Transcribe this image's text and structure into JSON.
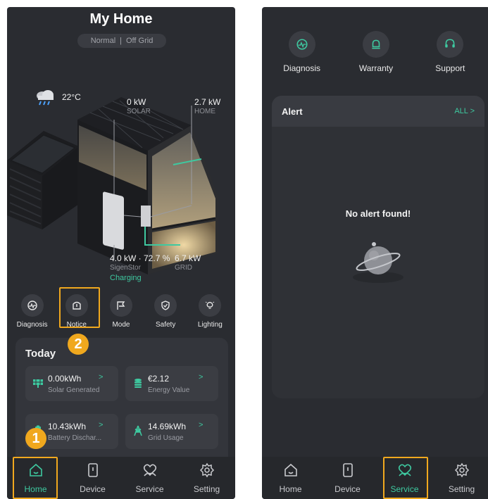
{
  "left": {
    "title": "My Home",
    "mode": {
      "normal": "Normal",
      "separator": "|",
      "off_grid": "Off Grid"
    },
    "weather": {
      "temp": "22°C",
      "icon": "rain-cloud-icon"
    },
    "solar": {
      "value": "0 kW",
      "label": "SOLAR"
    },
    "home": {
      "value": "2.7 kW",
      "label": "HOME"
    },
    "battery": {
      "value": "4.0 kW · 72.7 %",
      "label": "SigenStor",
      "status": "Charging"
    },
    "grid": {
      "value": "6.7 kW",
      "label": "GRID"
    },
    "features": [
      {
        "label": "Diagnosis",
        "icon": "diagnosis-icon"
      },
      {
        "label": "Notice",
        "icon": "notice-icon"
      },
      {
        "label": "Mode",
        "icon": "mode-icon"
      },
      {
        "label": "Safety",
        "icon": "safety-icon"
      },
      {
        "label": "Lighting",
        "icon": "lighting-icon"
      }
    ],
    "today": {
      "title": "Today",
      "tiles": [
        {
          "value": "0.00kWh",
          "label": "Solar Generated",
          "chevron": ">",
          "icon": "solar-panel-icon"
        },
        {
          "value": "€2.12",
          "label": "Energy Value",
          "chevron": ">",
          "icon": "coins-icon"
        },
        {
          "value": "10.43kWh",
          "label": "Battery Dischar...",
          "chevron": ">",
          "icon": "battery-icon"
        },
        {
          "value": "14.69kWh",
          "label": "Grid Usage",
          "chevron": ">",
          "icon": "pylon-icon"
        }
      ]
    },
    "badges": {
      "one": "1",
      "two": "2"
    }
  },
  "right": {
    "services": [
      {
        "label": "Diagnosis",
        "icon": "diagnosis-icon"
      },
      {
        "label": "Warranty",
        "icon": "bell-icon"
      },
      {
        "label": "Support",
        "icon": "headset-icon"
      }
    ],
    "alert": {
      "title": "Alert",
      "all": "ALL >",
      "empty": "No alert found!"
    }
  },
  "tabs": [
    {
      "label": "Home",
      "icon": "home-icon"
    },
    {
      "label": "Device",
      "icon": "device-icon"
    },
    {
      "label": "Service",
      "icon": "service-icon"
    },
    {
      "label": "Setting",
      "icon": "gear-icon"
    }
  ],
  "colors": {
    "accent": "#3ec9a0",
    "highlight": "#f0a81e",
    "background": "#2a2c31"
  }
}
